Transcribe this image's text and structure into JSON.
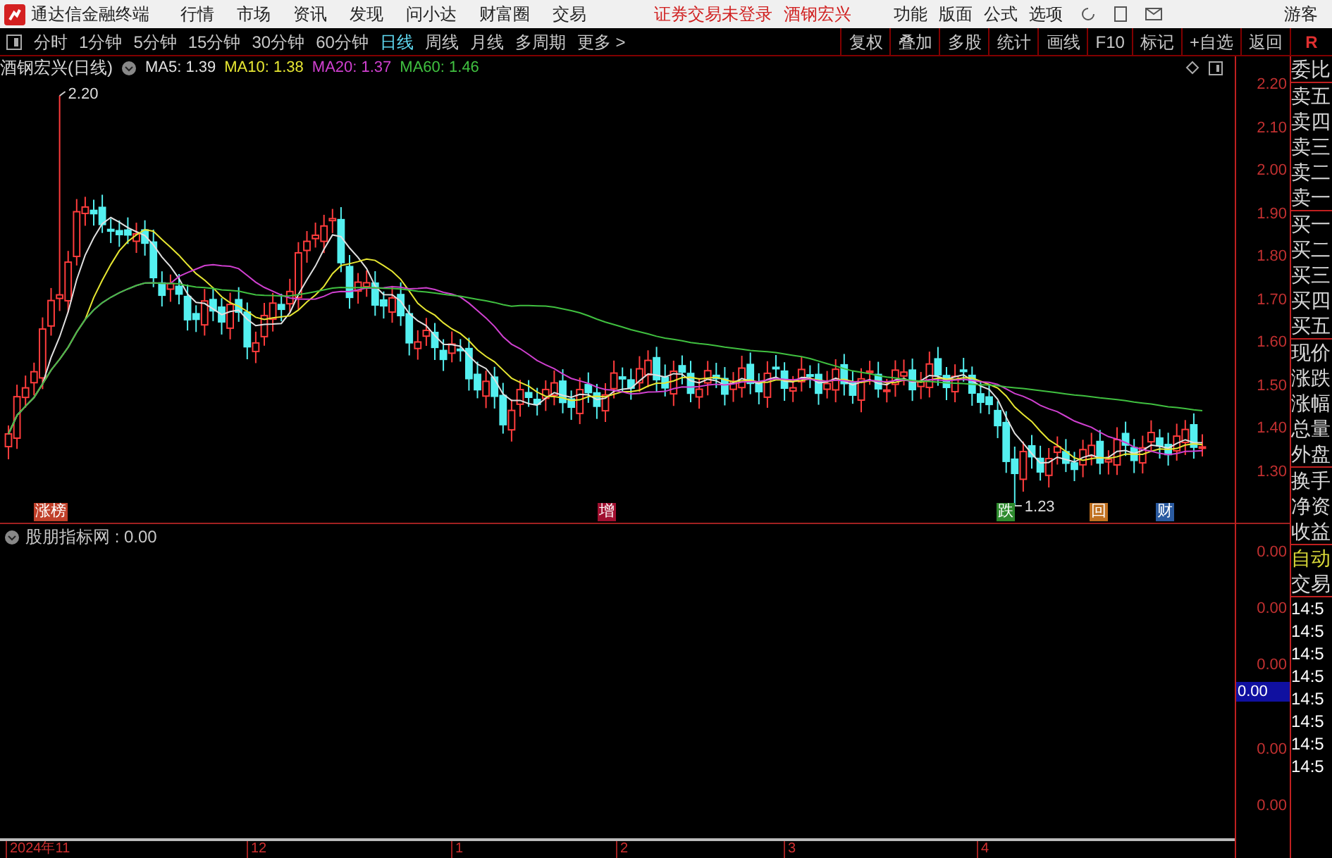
{
  "menu_bar": {
    "app_title": "通达信金融终端",
    "items": [
      "行情",
      "市场",
      "资讯",
      "发现",
      "问小达",
      "财富圈",
      "交易"
    ],
    "notice": "证券交易未登录",
    "stock": "酒钢宏兴",
    "right_items": [
      "功能",
      "版面",
      "公式",
      "选项"
    ],
    "user": "游客"
  },
  "toolbar": {
    "periods": [
      {
        "label": "分时",
        "selected": false
      },
      {
        "label": "1分钟",
        "selected": false
      },
      {
        "label": "5分钟",
        "selected": false
      },
      {
        "label": "15分钟",
        "selected": false
      },
      {
        "label": "30分钟",
        "selected": false
      },
      {
        "label": "60分钟",
        "selected": false
      },
      {
        "label": "日线",
        "selected": true
      },
      {
        "label": "周线",
        "selected": false
      },
      {
        "label": "月线",
        "selected": false
      },
      {
        "label": "多周期",
        "selected": false
      },
      {
        "label": "更多 >",
        "selected": false
      }
    ],
    "buttons": [
      "复权",
      "叠加",
      "多股",
      "统计",
      "画线",
      "F10",
      "标记",
      "+自选",
      "返回"
    ],
    "corner": "R"
  },
  "main_chart": {
    "title": "酒钢宏兴(日线)",
    "ma": [
      {
        "label": "MA5: 1.39",
        "color": "#e0e0e0"
      },
      {
        "label": "MA10: 1.38",
        "color": "#e6e632"
      },
      {
        "label": "MA20: 1.37",
        "color": "#d040d0"
      },
      {
        "label": "MA60: 1.46",
        "color": "#40c040"
      }
    ],
    "high_label": "2.20",
    "low_label": "1.23",
    "price_ticks": [
      "2.20",
      "2.10",
      "2.00",
      "1.90",
      "1.80",
      "1.70",
      "1.60",
      "1.50",
      "1.40",
      "1.30"
    ],
    "markers": [
      {
        "label": "涨榜",
        "color": "#c0402a"
      },
      {
        "label": "增",
        "color": "#a01030"
      },
      {
        "label": "跌",
        "color": "#2e8b2e"
      },
      {
        "label": "回",
        "color": "#c07020"
      },
      {
        "label": "财",
        "color": "#2a5aa0"
      }
    ]
  },
  "quote_panel": {
    "groups": [
      [
        "委比"
      ],
      [
        "卖五",
        "卖四",
        "卖三",
        "卖二",
        "卖一"
      ],
      [
        "买一",
        "买二",
        "买三",
        "买四",
        "买五"
      ],
      [
        "现价",
        "涨跌",
        "涨幅",
        "总量",
        "外盘"
      ],
      [
        "换手",
        "净资",
        "收益"
      ]
    ]
  },
  "indicator": {
    "title": "股朋指标网 : 0.00",
    "ticks": [
      "0.00",
      "0.00",
      "0.00",
      "0.00",
      "0.00"
    ],
    "cursor_value": "0.00",
    "mode": "自动",
    "trade_label": "交易",
    "times": [
      "14:5",
      "14:5",
      "14:5",
      "14:5",
      "14:5",
      "14:5",
      "14:5",
      "14:5"
    ]
  },
  "x_axis": [
    "2024年11",
    "12",
    "1",
    "2",
    "3",
    "4"
  ]
}
